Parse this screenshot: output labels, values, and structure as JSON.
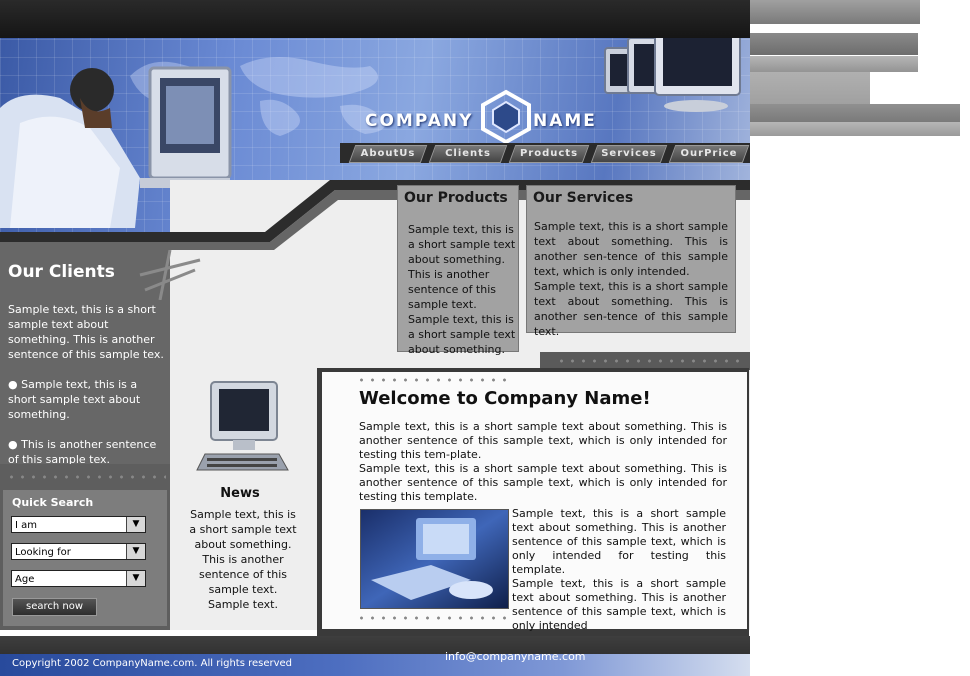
{
  "header": {
    "logo_word1": "COMPANY",
    "logo_word2": "NAME",
    "nav": [
      "AboutUs",
      "Clients",
      "Products",
      "Services",
      "OurPrice"
    ]
  },
  "clients": {
    "title": "Our Clients",
    "para1": "Sample text, this is a short sample text about something. This is another sentence of this sample tex.",
    "bullet1": "Sample text, this is a short sample text about something.",
    "bullet2": "This is another sentence of this  sample tex."
  },
  "quick_search": {
    "title": "Quick Search",
    "select1": "I am",
    "select2": "Looking for",
    "select3": "Age",
    "button": "search now"
  },
  "products": {
    "title": "Our Products",
    "text": "Sample text, this is a short sample text about something. This is another sentence of this  sample text. Sample text, this is a short sample text about something."
  },
  "services": {
    "title": "Our Services",
    "text1": "Sample text, this is a short sample text about something. This is another sen-tence of this  sample text, which is only intended.",
    "text2": "Sample text, this is a short sample text about something. This is another sen-tence of this  sample text."
  },
  "news": {
    "title": "News",
    "text": "Sample text, this is a short sample text about something. This is another sentence of this  sample text. Sample text."
  },
  "welcome": {
    "title": "Welcome to Company Name!",
    "para1": "Sample text, this is a short sample text about something. This is another sentence of this  sample text, which is only intended for testing this tem-plate.",
    "para2": "Sample text, this is a short sample text about something. This is another sentence of this  sample text, which is only intended for testing this template.",
    "side1": "Sample text, this is a short sample text about something. This is another sentence of this  sample text, which is only intended for testing this template.",
    "side2": "Sample text, this is a short sample text about something. This is another sentence of this  sample text, which is only intended"
  },
  "footer": {
    "copyright": "Copyright 2002 CompanyName.com. All rights reserved",
    "email": "info@companyname.com"
  },
  "colors": {
    "accent_blue": "#3b5aa6",
    "panel_gray": "#676767",
    "box_gray": "#a2a2a2"
  }
}
